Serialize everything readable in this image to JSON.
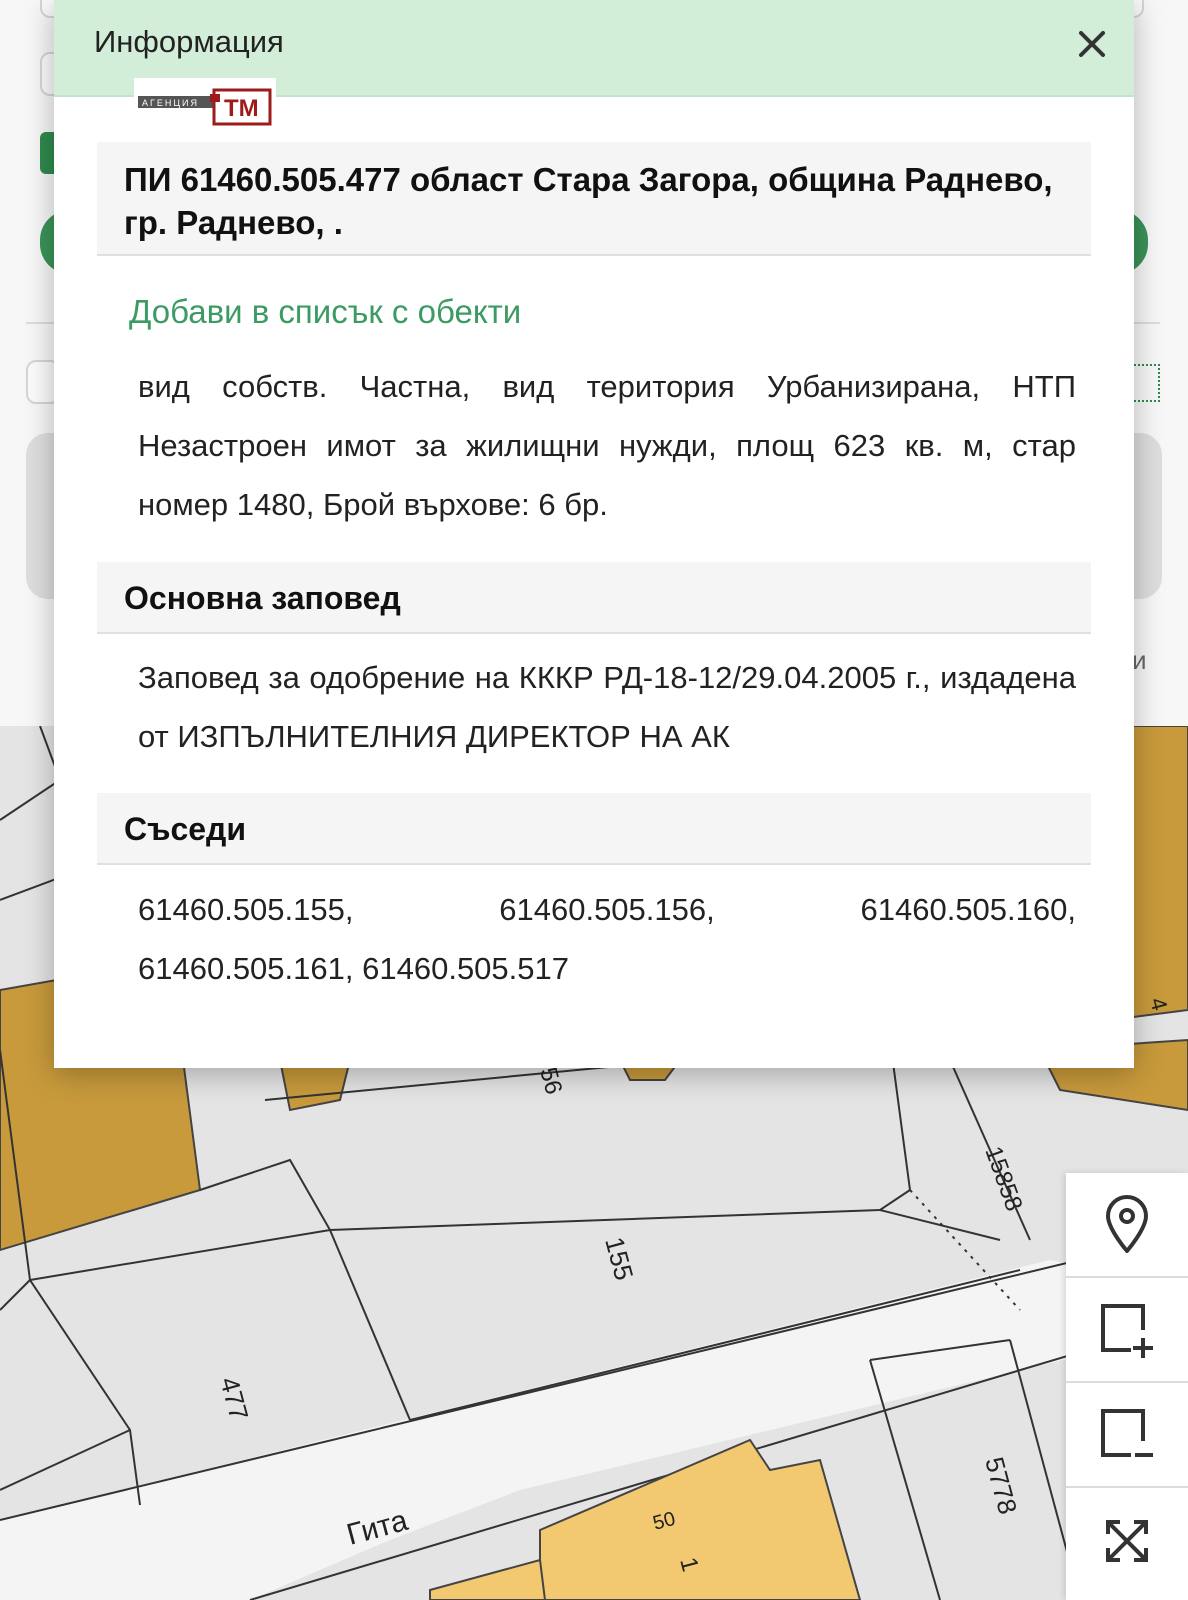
{
  "dialog": {
    "title": "Информация",
    "logo_text_small": "АГЕНЦИЯ",
    "logo_text_big": "ТМ",
    "property_title": "ПИ 61460.505.477 област Стара Загора, община Раднево, гр. Раднево, .",
    "add_to_list_label": "Добави в списък с обекти",
    "description": "вид собств. Частна, вид територия Урбанизирана, НТП Незастроен имот за жилищни нужди, площ 623 кв. м, стар номер 1480, Брой върхове: 6 бр.",
    "order_heading": "Основна заповед",
    "order_text": "Заповед за одобрение на КККР РД-18-12/29.04.2005 г., издадена от ИЗПЪЛНИТЕЛНИЯ ДИРЕКТОР НА АК",
    "neighbors_heading": "Съседи",
    "neighbors": [
      "61460.505.155,",
      "61460.505.156,",
      "61460.505.160,",
      "61460.505.161,",
      "61460.505.517"
    ]
  },
  "map": {
    "street_name": "Гита",
    "parcel_labels": [
      "477",
      "155",
      "5778",
      "15858",
      "56",
      "50",
      "1",
      "4"
    ],
    "colors": {
      "parcel_fill": "#e4e4e4",
      "building_fill": "#c89a3c",
      "building_light": "#f2c870",
      "street_fill": "#f4f4f4",
      "lines": "#333333"
    }
  },
  "toolbar": {
    "icons": [
      "map-pin-icon",
      "add-rectangle-icon",
      "remove-rectangle-icon",
      "expand-icon"
    ]
  },
  "colors": {
    "header_bg": "#d3eed8",
    "link_green": "#3c9a64",
    "brand_red": "#9e1b1b"
  },
  "underlay": {
    "partial_letter": "и"
  }
}
